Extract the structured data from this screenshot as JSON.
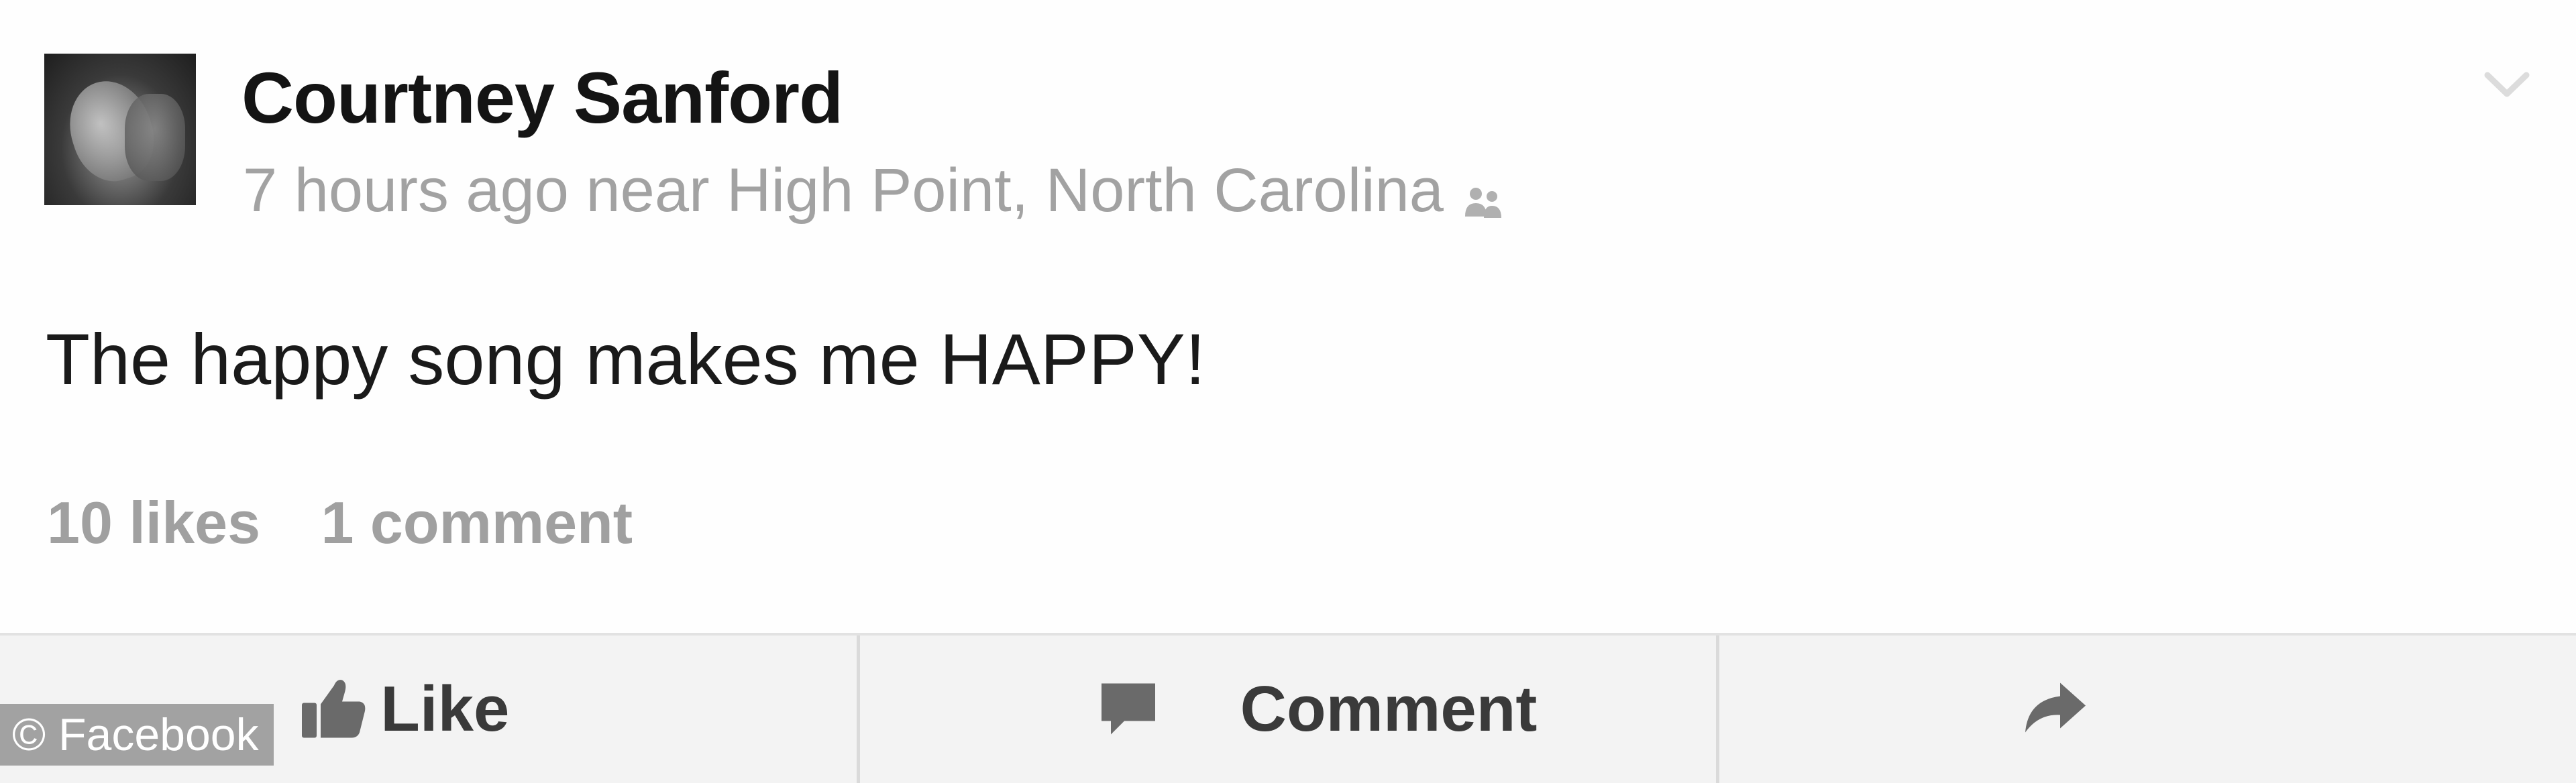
{
  "post": {
    "author_name": "Courtney Sanford",
    "meta_text": "7 hours ago near High Point, North Carolina",
    "audience_icon": "friends-icon",
    "menu_icon": "chevron-down-icon",
    "status_text": "The happy song makes me HAPPY!",
    "likes_text": "10 likes",
    "comments_text": "1 comment"
  },
  "actions": {
    "like_label": "Like",
    "like_icon": "thumbs-up-icon",
    "comment_label": "Comment",
    "comment_icon": "speech-bubble-icon",
    "share_icon": "share-arrow-icon"
  },
  "watermark": {
    "text": "© Facebook"
  },
  "colors": {
    "background": "#fefefe",
    "author": "#141414",
    "meta": "#a2a2a2",
    "counts": "#a0a0a0",
    "action_bar": "#f3f3f3",
    "action_label": "#3a3a3a"
  }
}
